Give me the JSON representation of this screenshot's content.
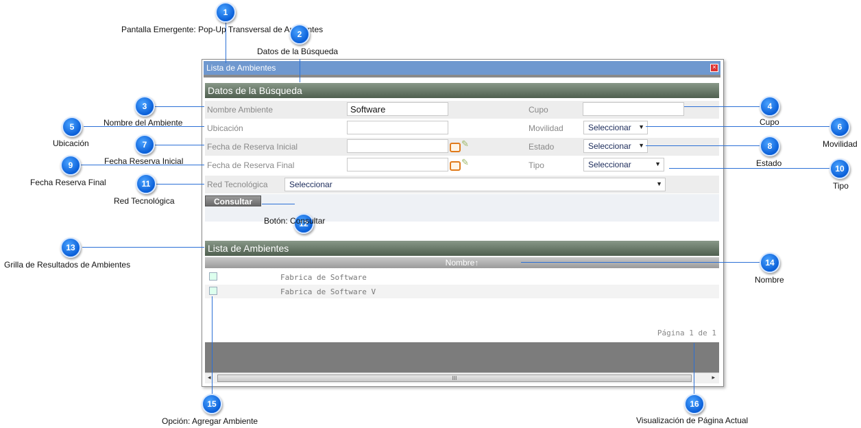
{
  "window": {
    "title": "Lista de Ambientes",
    "close_label": "×"
  },
  "search": {
    "header": "Datos de la Búsqueda",
    "fields": {
      "nombre_label": "Nombre Ambiente",
      "nombre_value": "Software",
      "ubicacion_label": "Ubicación",
      "ubicacion_value": "",
      "fecha_ini_label": "Fecha de Reserva Inicial",
      "fecha_ini_value": "",
      "fecha_fin_label": "Fecha de Reserva Final",
      "fecha_fin_value": "",
      "cupo_label": "Cupo",
      "cupo_value": "",
      "movilidad_label": "Movilidad",
      "movilidad_value": "Seleccionar",
      "estado_label": "Estado",
      "estado_value": "Seleccionar",
      "tipo_label": "Tipo",
      "tipo_value": "Seleccionar",
      "red_label": "Red Tecnológica",
      "red_value": "Seleccionar"
    },
    "consult_button": "Consultar"
  },
  "results": {
    "header": "Lista de Ambientes",
    "column": "Nombre↑",
    "rows": [
      "Fabrica de Software",
      "Fabrica de Software V"
    ],
    "pager": "Página 1 de 1"
  },
  "scrollbar": {
    "thumb_grip": "III",
    "left_arrow": "◂",
    "right_arrow": "▸"
  },
  "callouts": {
    "c1": "1",
    "c2": "2",
    "c3": "3",
    "c4": "4",
    "c5": "5",
    "c6": "6",
    "c7": "7",
    "c8": "8",
    "c9": "9",
    "c10": "10",
    "c11": "11",
    "c12": "12",
    "c13": "13",
    "c14": "14",
    "c15": "15",
    "c16": "16"
  },
  "labels": {
    "l1": "Pantalla Emergente: Pop-Up Transversal de Ambientes",
    "l2": "Datos de la Búsqueda",
    "l3": "Nombre del Ambiente",
    "l4": "Cupo",
    "l5": "Ubicación",
    "l6": "Movilidad",
    "l7": "Fecha Reserva Inicial",
    "l8": "Estado",
    "l9": "Fecha Reserva Final",
    "l10": "Tipo",
    "l11": "Red Tecnológica",
    "l12": "Botón: Consultar",
    "l13": "Grilla de Resultados de Ambientes",
    "l14": "Nombre",
    "l15": "Opción: Agregar Ambiente",
    "l16": "Visualización de Página Actual"
  },
  "icons": {
    "close": "close-icon",
    "calendar": "calendar-icon",
    "clear": "clear-date-icon",
    "add": "add-ambiente-icon",
    "dropdown": "chevron-down-icon"
  }
}
